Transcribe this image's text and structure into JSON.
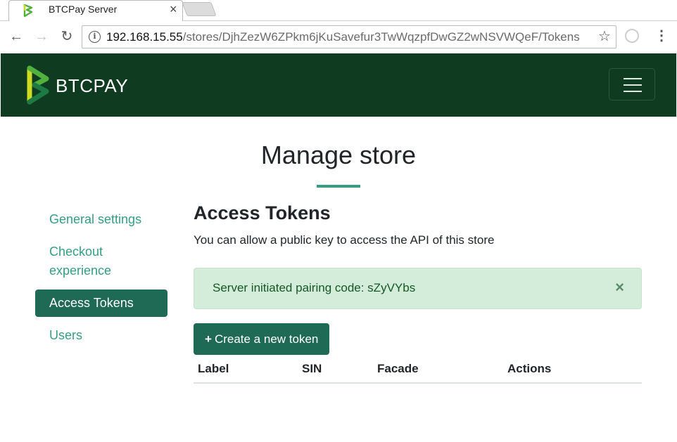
{
  "browser": {
    "tab_title": "BTCPay Server",
    "tab_close": "×",
    "url_host": "192.168.15.55",
    "url_path": "/stores/DjhZezW6ZPkm6jKuSavefur3TwWqzpfDwGZ2wNSVWQeF/Tokens",
    "info_glyph": "i",
    "star_glyph": "☆",
    "menu_glyph": "⋮",
    "back_glyph": "←",
    "forward_glyph": "→",
    "reload_glyph": "↻"
  },
  "header": {
    "brand": "BTCPAY",
    "bg_color": "#0f3b21",
    "logo_colors": [
      "#cedc21",
      "#51b13e",
      "#1e7a44"
    ]
  },
  "page": {
    "title": "Manage store",
    "accent_color": "#329f80"
  },
  "sidebar": {
    "items": [
      {
        "label": "General settings",
        "active": false
      },
      {
        "label": "Checkout experience",
        "active": false
      },
      {
        "label": "Access Tokens",
        "active": true
      },
      {
        "label": "Users",
        "active": false
      }
    ]
  },
  "main": {
    "section_title": "Access Tokens",
    "description": "You can allow a public key to access the API of this store",
    "alert": {
      "text": "Server initiated pairing code: sZyVYbs",
      "close": "×",
      "bg_color": "#d4edda"
    },
    "create_button": {
      "icon": "plus-icon",
      "plus": "+",
      "label": "Create a new token"
    },
    "table": {
      "columns": [
        "Label",
        "SIN",
        "Facade",
        "Actions"
      ],
      "rows": []
    }
  }
}
